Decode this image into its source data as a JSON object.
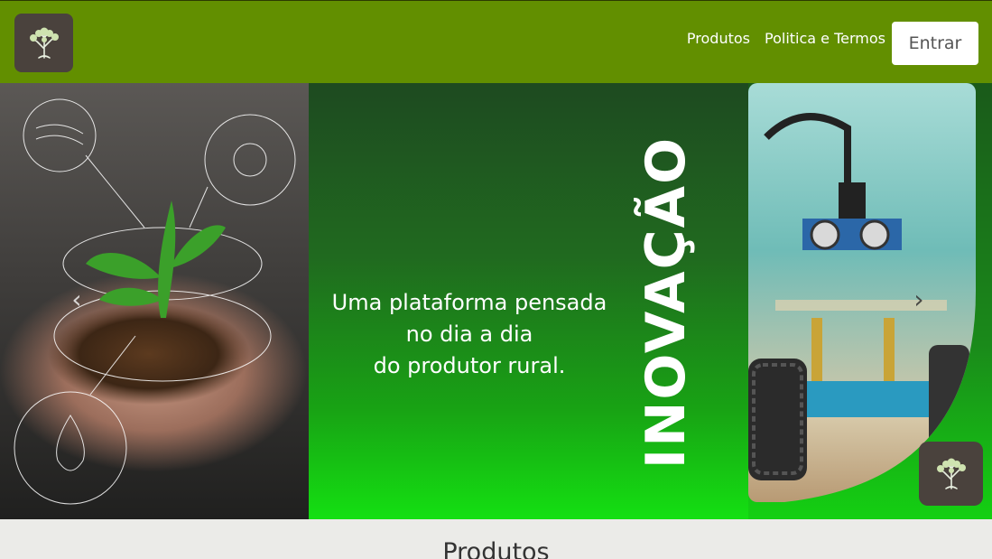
{
  "header": {
    "nav": [
      "Produtos",
      "Politica e Termos"
    ],
    "login_label": "Entrar",
    "logo_icon": "tree-icon",
    "brand_color": "#628f00"
  },
  "hero": {
    "headline_lines": [
      "Uma plataforma pensada",
      "no dia a dia",
      "do produtor rural."
    ],
    "vertical_word": "INOVAÇÃO",
    "prev_icon": "chevron-left-icon",
    "next_icon": "chevron-right-icon",
    "badge_icon": "tree-icon"
  },
  "section": {
    "title": "Produtos"
  }
}
